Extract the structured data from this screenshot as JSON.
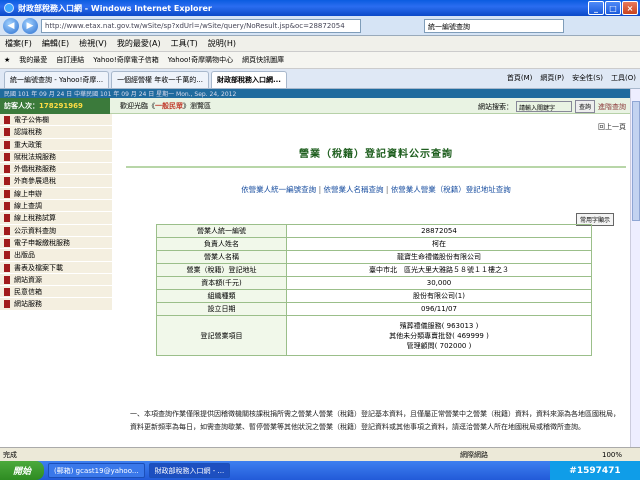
{
  "window": {
    "title": "財政部稅務入口網 - Windows Internet Explorer"
  },
  "browser": {
    "url": "http://www.etax.nat.gov.tw/wSite/sp?xdUrl=/wSite/query/NoResult.jsp&oc=28872054",
    "search_placeholder": "統一編號查詢",
    "menu": [
      "檔案(F)",
      "編輯(E)",
      "檢視(V)",
      "我的最愛(A)",
      "工具(T)",
      "說明(H)"
    ],
    "favorites": [
      "我的最愛",
      "自訂連結",
      "Yahoo!奇摩電子信箱",
      "Yahoo!奇摩購物中心",
      "網頁快訊圖庫"
    ],
    "tabs": [
      "統一編號查詢 - Yahoo!奇摩...",
      "一個經營權 年收一千萬的...",
      "財政部稅務入口網..."
    ],
    "tools": [
      "首頁(M)",
      "網頁(P)",
      "安全性(S)",
      "工具(O)"
    ]
  },
  "site": {
    "strip": "民國 101 年 09 月 24 日 中華民國 101 年 09 月 24 日 星期一 Mon., Sep. 24, 2012",
    "visitors_label": "訪客人次：",
    "visitors_count": "178291969",
    "welcome_prefix": "歡迎光臨《",
    "welcome_highlight": "一般民眾",
    "welcome_suffix": "》瀏覽區",
    "search_label": "網站搜索：",
    "search_placeholder": "請輸入關鍵字",
    "search_button": "查詢",
    "advanced_search": "進階查詢"
  },
  "sidebar": {
    "items": [
      "電子公佈欄",
      "認識稅務",
      "重大政策",
      "賦稅法規服務",
      "外僑稅務服務",
      "外商參展退稅",
      "線上申辦",
      "線上查調",
      "線上稅務試算",
      "公示資料查詢",
      "電子申報繳稅服務",
      "出版品",
      "書表及檔案下載",
      "網站資源",
      "民意信箱",
      "網站服務"
    ]
  },
  "content": {
    "back_link": "回上一頁",
    "heading": "營業（稅籍）登記資料公示查詢",
    "links": [
      "依營業人統一編號查詢",
      "依營業人名稱查詢",
      "依營業人營業（稅籍）登記地址查詢"
    ],
    "hint_button": "常用字顯示",
    "table": [
      {
        "label": "營業人統一編號",
        "value": "28872054"
      },
      {
        "label": "負責人姓名",
        "value": "柯在"
      },
      {
        "label": "營業人名稱",
        "value": "龍寶生命禮儀股份有限公司"
      },
      {
        "label": "營業（稅籍）登記地址",
        "value": "臺中市北　區光大里大雅路５８號１１樓之３"
      },
      {
        "label": "資本額(千元)",
        "value": "30,000"
      },
      {
        "label": "組織種類",
        "value": "股份有限公司(1)"
      },
      {
        "label": "設立日期",
        "value": "096/11/07"
      }
    ],
    "business_label": "登記營業項目",
    "business_items": [
      "殯葬禮儀服務( 963013 )",
      "其他未分類專賣批發( 469999 )",
      "管理顧問( 702000 )"
    ],
    "notes": "一、本項查詢作業僅限提供因稽徵機關核課稅捐所需之營業人營業（稅籍）登記基本資料，且僅屬正常營業中之營業（稅籍）資料，資料來源為各地區國稅局，資料更新頻率為每日，如需查詢歇業、暫停營業等其他狀況之營業（稅籍）登記資料或其他事項之資料，請逕洽營業人所在地國稅局或稽徵所查詢。"
  },
  "status": {
    "left": "完成",
    "zone": "網際網路",
    "zoom": "100%"
  },
  "taskbar": {
    "start": "開始",
    "tasks": [
      "(郵箱) gcast19@yahoo...",
      "財政部稅務入口網 - ..."
    ],
    "tray": "#1597471"
  }
}
